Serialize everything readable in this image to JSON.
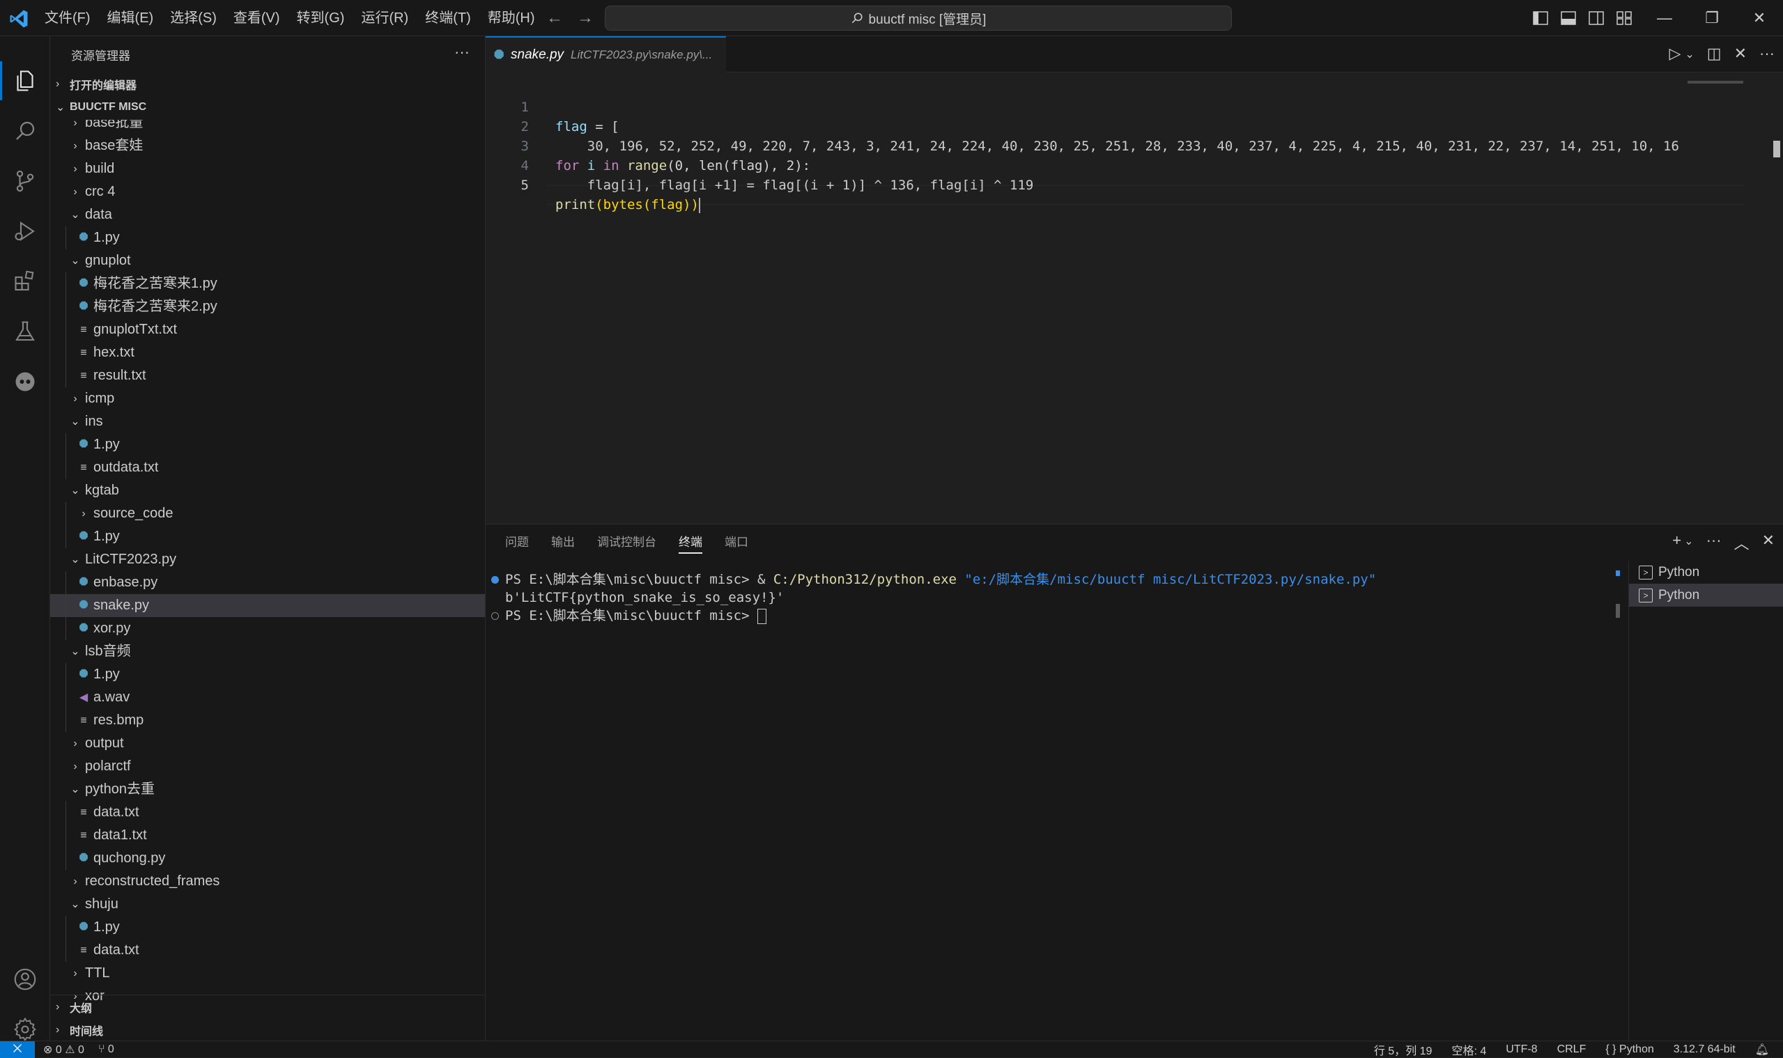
{
  "menu": [
    "文件(F)",
    "编辑(E)",
    "选择(S)",
    "查看(V)",
    "转到(G)",
    "运行(R)",
    "终端(T)",
    "帮助(H)"
  ],
  "command_center": "buuctf misc [管理员]",
  "sidebar": {
    "title": "资源管理器",
    "open_editors": "打开的编辑器",
    "workspace": "BUUCTF MISC",
    "outline": "大纲",
    "timeline": "时间线"
  },
  "tree": [
    {
      "label": "base批量",
      "depth": 1,
      "type": "folder",
      "open": false
    },
    {
      "label": "base套娃",
      "depth": 1,
      "type": "folder",
      "open": false
    },
    {
      "label": "build",
      "depth": 1,
      "type": "folder",
      "open": false
    },
    {
      "label": "crc 4",
      "depth": 1,
      "type": "folder",
      "open": false
    },
    {
      "label": "data",
      "depth": 1,
      "type": "folder",
      "open": true
    },
    {
      "label": "1.py",
      "depth": 2,
      "type": "py"
    },
    {
      "label": "gnuplot",
      "depth": 1,
      "type": "folder",
      "open": true
    },
    {
      "label": "梅花香之苦寒来1.py",
      "depth": 2,
      "type": "py"
    },
    {
      "label": "梅花香之苦寒来2.py",
      "depth": 2,
      "type": "py"
    },
    {
      "label": "gnuplotTxt.txt",
      "depth": 2,
      "type": "txt"
    },
    {
      "label": "hex.txt",
      "depth": 2,
      "type": "txt"
    },
    {
      "label": "result.txt",
      "depth": 2,
      "type": "txt"
    },
    {
      "label": "icmp",
      "depth": 1,
      "type": "folder",
      "open": false
    },
    {
      "label": "ins",
      "depth": 1,
      "type": "folder",
      "open": true
    },
    {
      "label": "1.py",
      "depth": 2,
      "type": "py"
    },
    {
      "label": "outdata.txt",
      "depth": 2,
      "type": "txt"
    },
    {
      "label": "kgtab",
      "depth": 1,
      "type": "folder",
      "open": true
    },
    {
      "label": "source_code",
      "depth": 2,
      "type": "folder",
      "open": false
    },
    {
      "label": "1.py",
      "depth": 2,
      "type": "py"
    },
    {
      "label": "LitCTF2023.py",
      "depth": 1,
      "type": "folder",
      "open": true
    },
    {
      "label": "enbase.py",
      "depth": 2,
      "type": "py"
    },
    {
      "label": "snake.py",
      "depth": 2,
      "type": "py",
      "selected": true
    },
    {
      "label": "xor.py",
      "depth": 2,
      "type": "py"
    },
    {
      "label": "lsb音频",
      "depth": 1,
      "type": "folder",
      "open": true
    },
    {
      "label": "1.py",
      "depth": 2,
      "type": "py"
    },
    {
      "label": "a.wav",
      "depth": 2,
      "type": "wav"
    },
    {
      "label": "res.bmp",
      "depth": 2,
      "type": "txt"
    },
    {
      "label": "output",
      "depth": 1,
      "type": "folder",
      "open": false
    },
    {
      "label": "polarctf",
      "depth": 1,
      "type": "folder",
      "open": false
    },
    {
      "label": "python去重",
      "depth": 1,
      "type": "folder",
      "open": true
    },
    {
      "label": "data.txt",
      "depth": 2,
      "type": "txt"
    },
    {
      "label": "data1.txt",
      "depth": 2,
      "type": "txt"
    },
    {
      "label": "quchong.py",
      "depth": 2,
      "type": "py"
    },
    {
      "label": "reconstructed_frames",
      "depth": 1,
      "type": "folder",
      "open": false
    },
    {
      "label": "shuju",
      "depth": 1,
      "type": "folder",
      "open": true
    },
    {
      "label": "1.py",
      "depth": 2,
      "type": "py"
    },
    {
      "label": "data.txt",
      "depth": 2,
      "type": "txt"
    },
    {
      "label": "TTL",
      "depth": 1,
      "type": "folder",
      "open": false
    },
    {
      "label": "xor",
      "depth": 1,
      "type": "folder",
      "open": false
    }
  ],
  "editor": {
    "tab_name": "snake.py",
    "tab_path": "LitCTF2023.py\\snake.py\\...",
    "line_numbers": [
      "1",
      "2",
      "3",
      "4",
      "5"
    ],
    "code": {
      "l1_var": "flag",
      "l1_rest": " = [",
      "l2": "    30, 196, 52, 252, 49, 220, 7, 243, 3, 241, 24, 224, 40, 230, 25, 251, 28, 233, 40, 237, 4, 225, 4, 215, 40, 231, 22, 237, 14, 251, 10, 16",
      "l3_for": "for",
      "l3_i": " i ",
      "l3_in": "in",
      "l3_range": " range",
      "l3_args": "(0, len(flag), 2):",
      "l4": "    flag[i], flag[i +1] = flag[(i + 1)] ^ 136, flag[i] ^ 119",
      "l5_print": "print",
      "l5_rest": "(bytes(flag))"
    }
  },
  "panel": {
    "tabs": [
      "问题",
      "输出",
      "调试控制台",
      "终端",
      "端口"
    ],
    "active_tab": "终端",
    "terminal": {
      "line1_prompt": "PS E:\\脚本合集\\misc\\buuctf misc> & ",
      "line1_cmd": "C:/Python312/python.exe",
      "line1_arg": " \"e:/脚本合集/misc/buuctf misc/LitCTF2023.py/snake.py\"",
      "line2": "b'LitCTF{python_snake_is_so_easy!}'",
      "line3_prompt": "PS E:\\脚本合集\\misc\\buuctf misc> "
    },
    "terminal_list": [
      "Python",
      "Python"
    ]
  },
  "statusbar": {
    "errors": "⊗ 0 ⚠ 0",
    "ports": "⑂ 0",
    "position": "行 5，列 19",
    "spaces": "空格: 4",
    "encoding": "UTF-8",
    "eol": "CRLF",
    "language": "{ } Python",
    "interpreter": "3.12.7 64-bit"
  },
  "colors": {
    "accent": "#0078d4",
    "python_icon": "#519aba",
    "wav_icon": "#a074c4"
  }
}
